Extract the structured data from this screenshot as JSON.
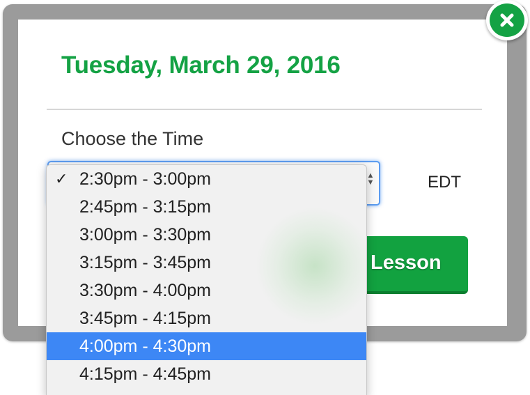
{
  "modal": {
    "date_title": "Tuesday, March 29, 2016",
    "choose_label": "Choose the Time",
    "timezone": "EDT",
    "lesson_button_label": "Lesson",
    "close_icon": "close-x-icon"
  },
  "time_select": {
    "checked_index": 0,
    "highlighted_index": 6,
    "options": [
      "2:30pm - 3:00pm",
      "2:45pm - 3:15pm",
      "3:00pm - 3:30pm",
      "3:15pm - 3:45pm",
      "3:30pm - 4:00pm",
      "3:45pm - 4:15pm",
      "4:00pm - 4:30pm",
      "4:15pm - 4:45pm"
    ],
    "check_mark": "✓"
  },
  "colors": {
    "accent_green": "#14a244",
    "highlight_blue": "#3d87f5",
    "focus_blue": "#5c9cf0"
  }
}
